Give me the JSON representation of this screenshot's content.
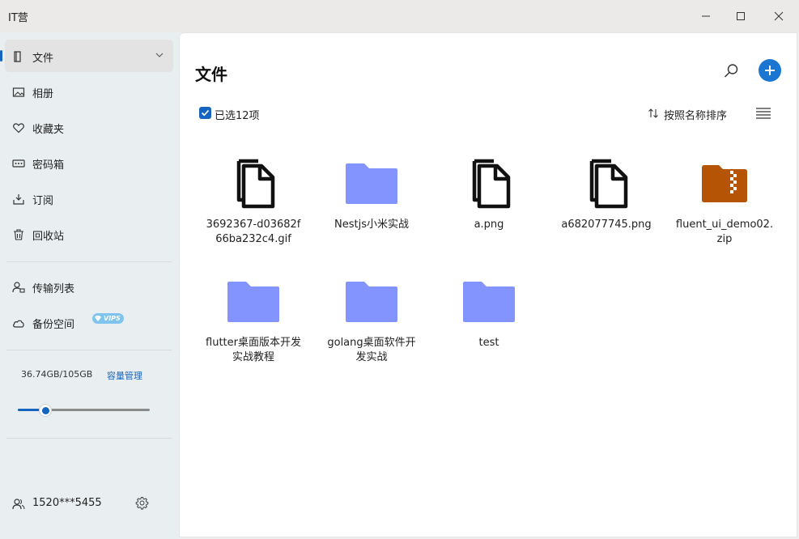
{
  "app": {
    "title": "IT营"
  },
  "sidebar": {
    "items": [
      {
        "label": "文件",
        "icon": "file-icon"
      },
      {
        "label": "相册",
        "icon": "photo-icon"
      },
      {
        "label": "收藏夹",
        "icon": "heart-icon"
      },
      {
        "label": "密码箱",
        "icon": "password-icon"
      },
      {
        "label": "订阅",
        "icon": "subscribe-icon"
      },
      {
        "label": "回收站",
        "icon": "trash-icon"
      },
      {
        "label": "传输列表",
        "icon": "transfer-icon"
      },
      {
        "label": "备份空间",
        "icon": "cloud-icon"
      }
    ],
    "vip": "VIPS",
    "storage": {
      "used_text": "36.74GB/105GB",
      "manage_label": "容量管理",
      "used_fraction": 0.35
    },
    "user": {
      "name": "1520***5455"
    }
  },
  "main": {
    "title": "文件",
    "selection_label": "已选12项",
    "sort_label": "按照名称排序",
    "accent": "#1976d2",
    "files": [
      {
        "name": "3692367-d03682f66ba232c4.gif",
        "type": "doc"
      },
      {
        "name": "Nestjs小米实战",
        "type": "folder"
      },
      {
        "name": "a.png",
        "type": "doc"
      },
      {
        "name": "a682077745.png",
        "type": "doc"
      },
      {
        "name": "fluent_ui_demo02.zip",
        "type": "zip"
      },
      {
        "name": "flutter桌面版本开发实战教程",
        "type": "folder"
      },
      {
        "name": "golang桌面软件开发实战",
        "type": "folder"
      },
      {
        "name": "test",
        "type": "folder"
      }
    ]
  }
}
